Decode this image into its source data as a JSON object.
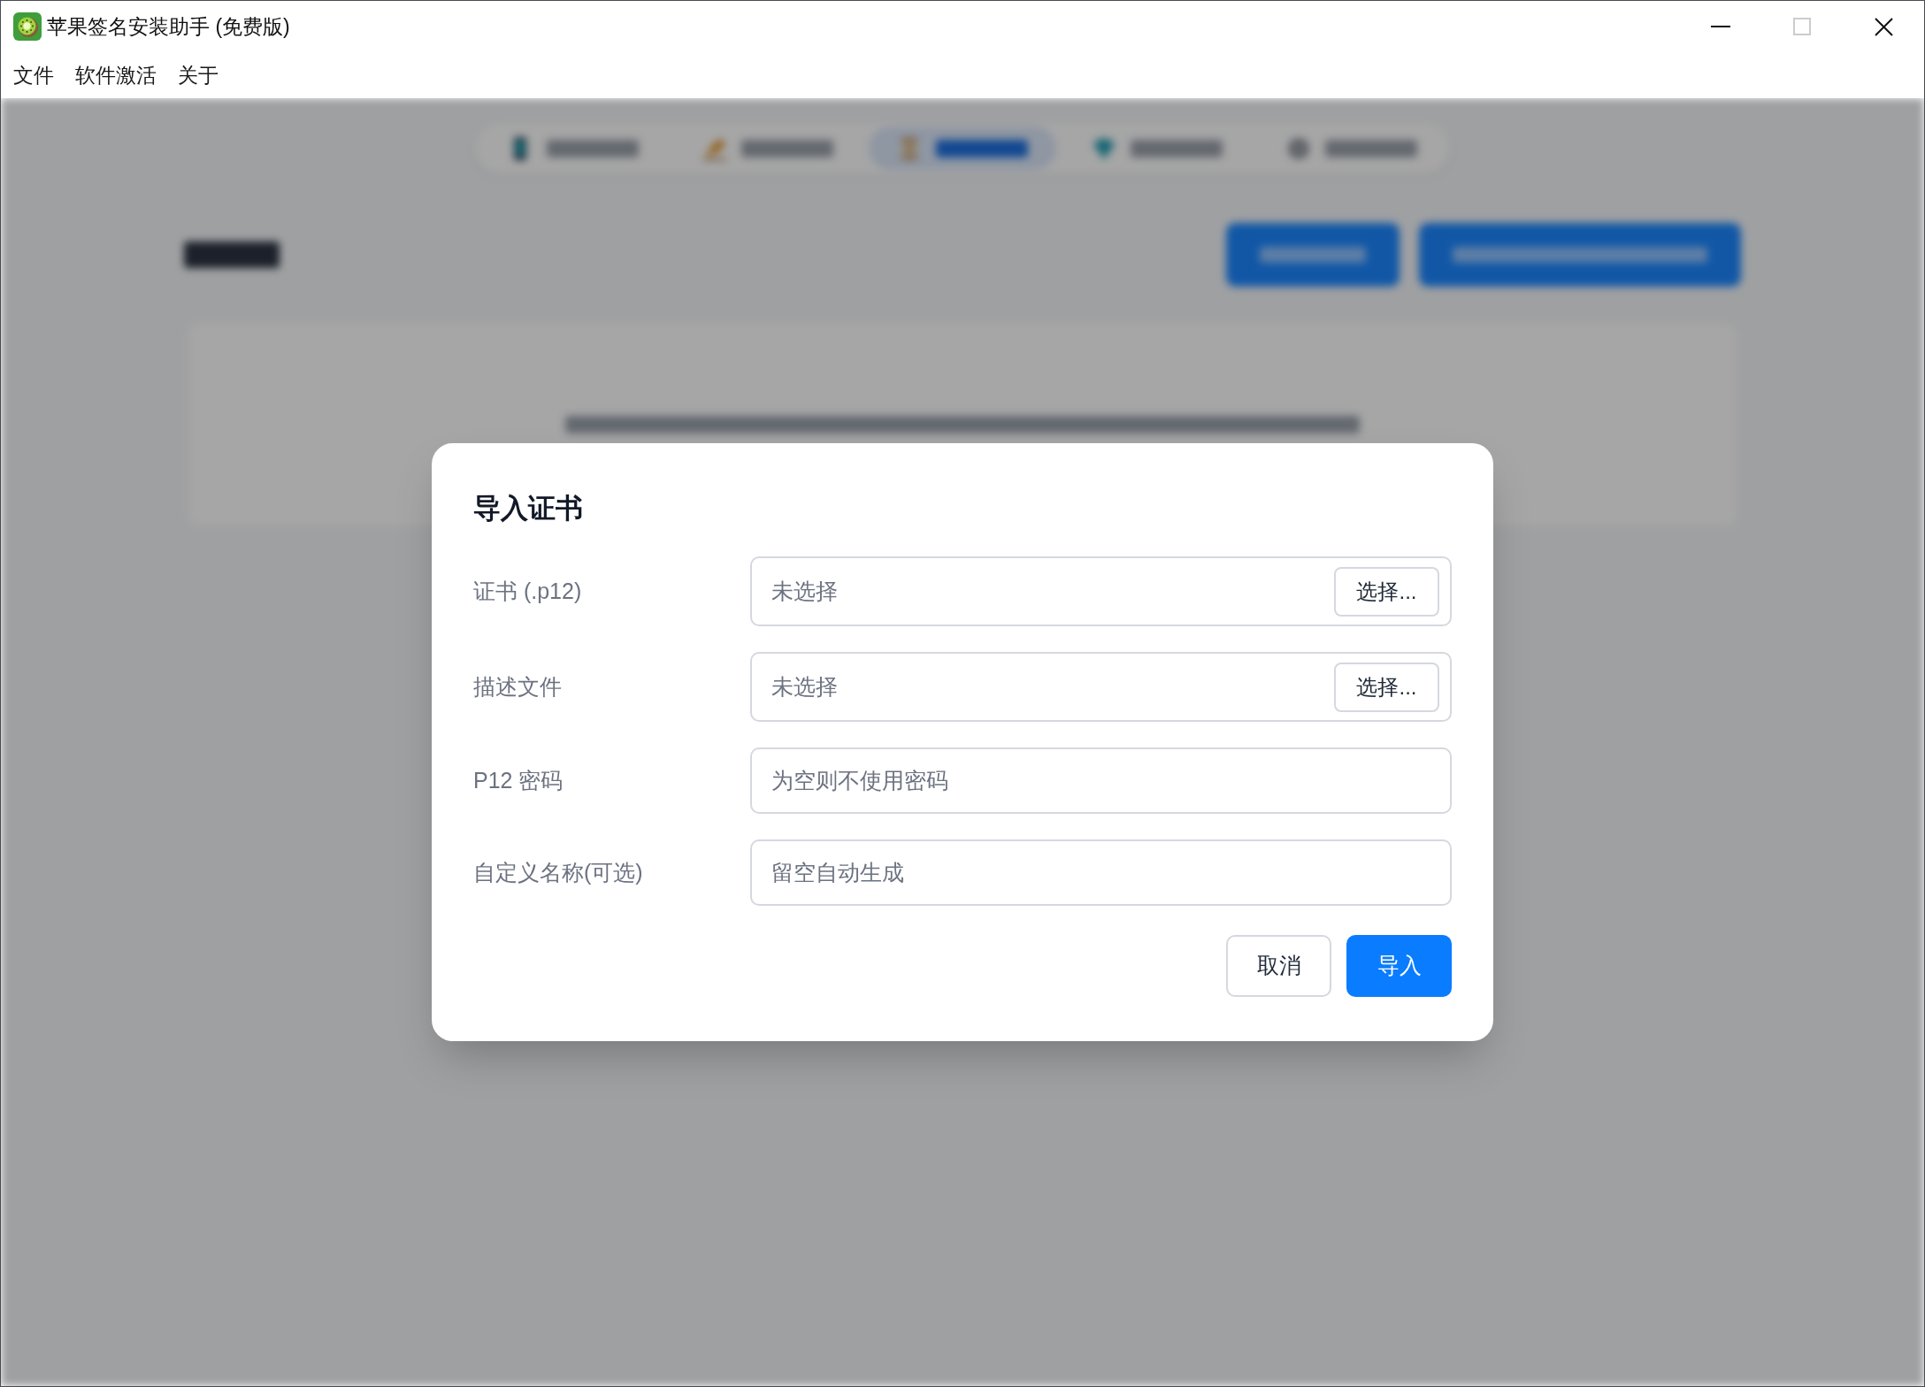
{
  "window": {
    "title": "苹果签名安装助手 (免费版)",
    "maximize_disabled": true
  },
  "menu": [
    {
      "label": "文件"
    },
    {
      "label": "软件激活"
    },
    {
      "label": "关于"
    }
  ],
  "background": {
    "tabs": [
      {
        "selected": false
      },
      {
        "selected": false
      },
      {
        "selected": true
      },
      {
        "selected": false
      },
      {
        "selected": false
      }
    ]
  },
  "dialog": {
    "title": "导入证书",
    "fields": [
      {
        "label": "证书 (.p12)",
        "kind": "file",
        "value": "未选择",
        "button": "选择..."
      },
      {
        "label": "描述文件",
        "kind": "file",
        "value": "未选择",
        "button": "选择..."
      },
      {
        "label": "P12 密码",
        "kind": "password",
        "placeholder": "为空则不使用密码"
      },
      {
        "label": "自定义名称(可选)",
        "kind": "text",
        "placeholder": "留空自动生成"
      }
    ],
    "buttons": [
      {
        "label": "取消",
        "kind": "cancel"
      },
      {
        "label": "导入",
        "kind": "confirm"
      }
    ]
  }
}
